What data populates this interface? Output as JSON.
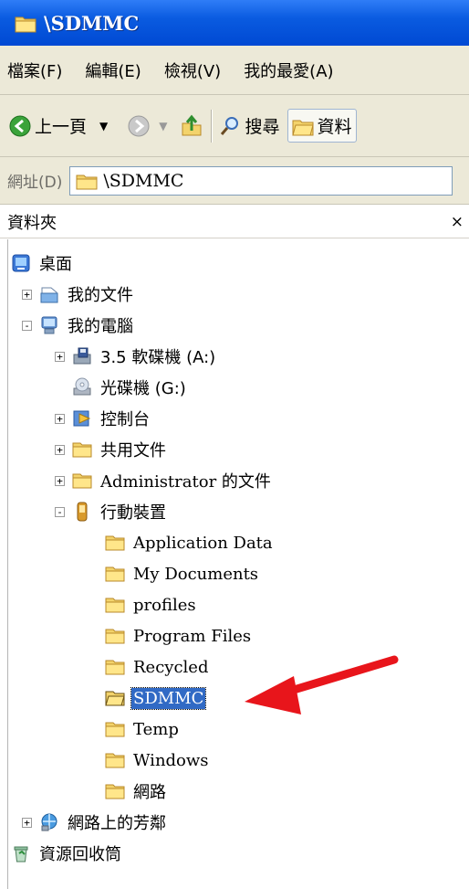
{
  "window": {
    "title": "\\SDMMC"
  },
  "menu": [
    "檔案(F)",
    "編輯(E)",
    "檢視(V)",
    "我的最愛(A)"
  ],
  "toolbar": {
    "back": "上一頁",
    "search": "搜尋",
    "folders": "資料"
  },
  "address": {
    "label": "網址(D)",
    "value": "\\SDMMC"
  },
  "panel": {
    "title": "資料夾",
    "close": "×"
  },
  "tree": [
    {
      "label": "桌面",
      "icon": "desktop-icon",
      "level": 0,
      "expander": ""
    },
    {
      "label": "我的文件",
      "icon": "my-documents-icon",
      "level": 1,
      "expander": "+"
    },
    {
      "label": "我的電腦",
      "icon": "my-computer-icon",
      "level": 1,
      "expander": "-"
    },
    {
      "label": "3.5 軟碟機 (A:)",
      "icon": "floppy-drive-icon",
      "level": 2,
      "expander": "+"
    },
    {
      "label": "光碟機 (G:)",
      "icon": "cd-drive-icon",
      "level": 2,
      "expander": ""
    },
    {
      "label": "控制台",
      "icon": "control-panel-icon",
      "level": 2,
      "expander": "+"
    },
    {
      "label": "共用文件",
      "icon": "folder-icon",
      "level": 2,
      "expander": "+"
    },
    {
      "label": "Administrator 的文件",
      "icon": "folder-icon",
      "level": 2,
      "expander": "+"
    },
    {
      "label": "行動裝置",
      "icon": "mobile-device-icon",
      "level": 2,
      "expander": "-"
    },
    {
      "label": "Application Data",
      "icon": "folder-icon",
      "level": 3,
      "expander": ""
    },
    {
      "label": "My Documents",
      "icon": "folder-icon",
      "level": 3,
      "expander": ""
    },
    {
      "label": "profiles",
      "icon": "folder-icon",
      "level": 3,
      "expander": ""
    },
    {
      "label": "Program Files",
      "icon": "folder-icon",
      "level": 3,
      "expander": ""
    },
    {
      "label": "Recycled",
      "icon": "folder-icon",
      "level": 3,
      "expander": ""
    },
    {
      "label": "SDMMC",
      "icon": "open-folder-icon",
      "level": 3,
      "expander": "",
      "selected": true
    },
    {
      "label": "Temp",
      "icon": "folder-icon",
      "level": 3,
      "expander": ""
    },
    {
      "label": "Windows",
      "icon": "folder-icon",
      "level": 3,
      "expander": ""
    },
    {
      "label": "網路",
      "icon": "folder-icon",
      "level": 3,
      "expander": ""
    },
    {
      "label": "網路上的芳鄰",
      "icon": "network-places-icon",
      "level": 0,
      "expander": "+"
    },
    {
      "label": "資源回收筒",
      "icon": "recycle-bin-icon",
      "level": 0,
      "expander": ""
    }
  ],
  "annotation": {
    "icon": "red-arrow-icon",
    "color": "#e8151b"
  }
}
